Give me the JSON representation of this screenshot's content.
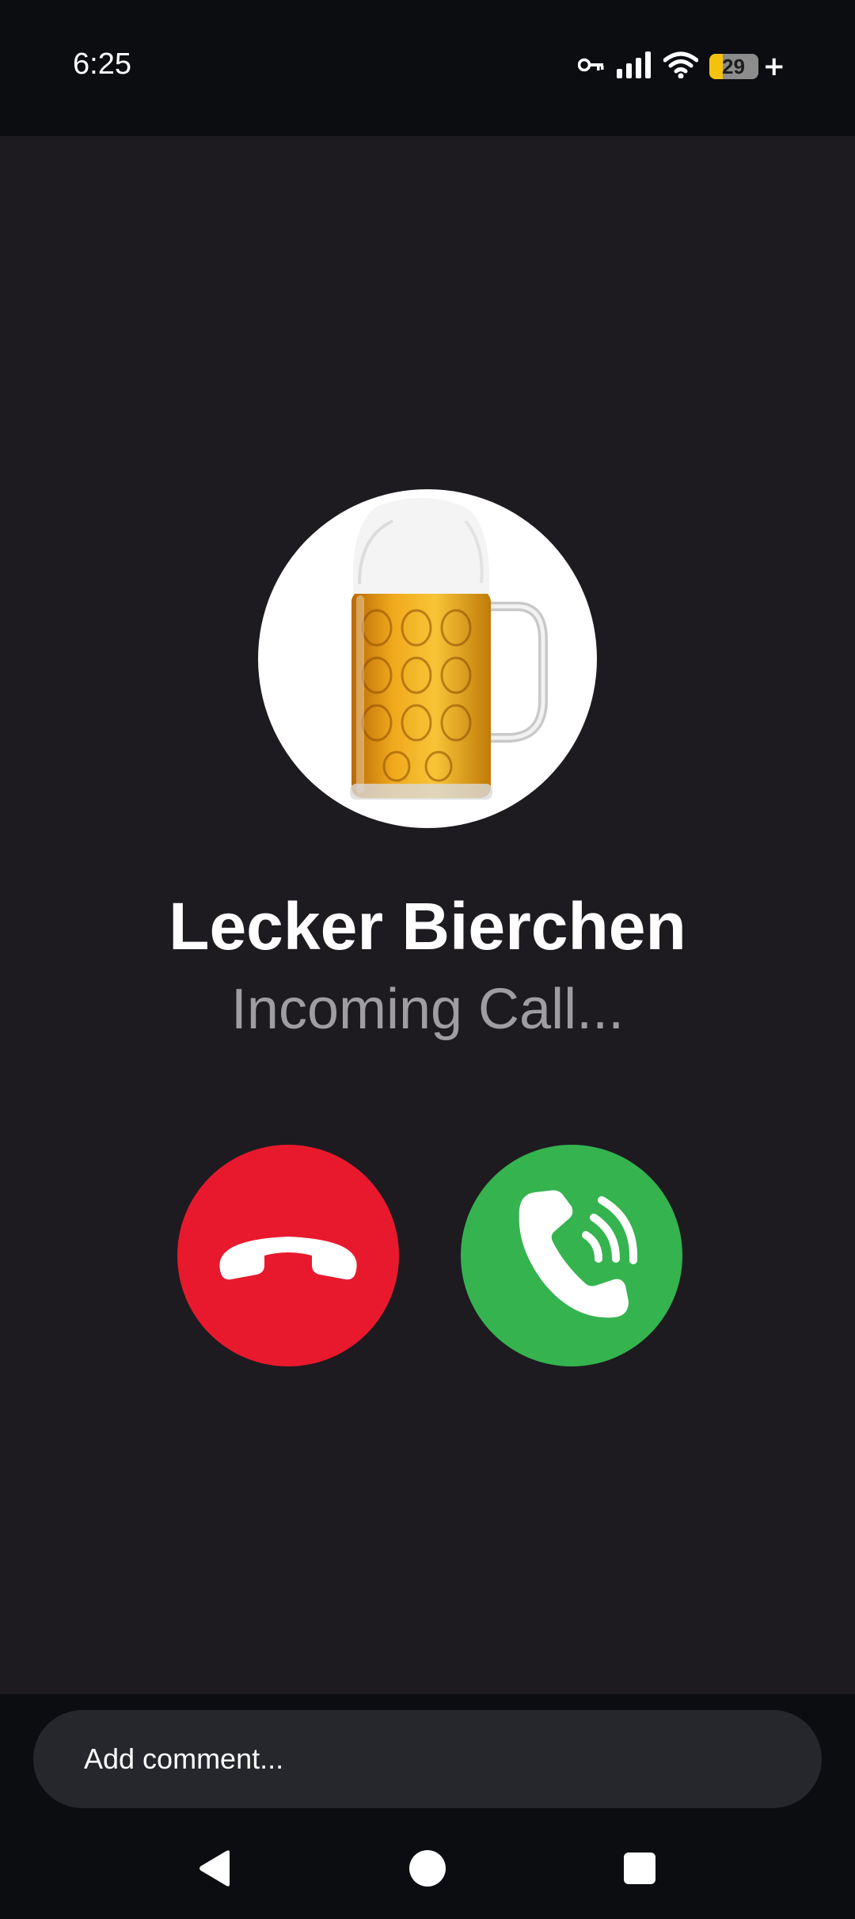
{
  "status_bar": {
    "time": "6:25",
    "battery_level": "29",
    "battery_fraction": 0.29,
    "icons": [
      "vpn-key-icon",
      "signal-icon",
      "wifi-icon",
      "battery-icon",
      "charging-plus-icon"
    ]
  },
  "call": {
    "caller_name": "Lecker Bierchen",
    "status_text": "Incoming Call...",
    "avatar_icon": "beer-mug-icon",
    "decline_icon": "hang-up-icon",
    "accept_icon": "phone-ringing-icon",
    "colors": {
      "decline": "#e8192c",
      "accept": "#35b34f",
      "background": "#1d1b20"
    }
  },
  "comment": {
    "placeholder": "Add comment..."
  },
  "nav": {
    "icons": [
      "back-icon",
      "home-icon",
      "recents-icon"
    ]
  }
}
